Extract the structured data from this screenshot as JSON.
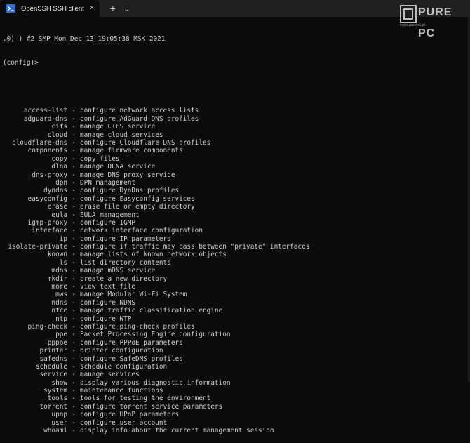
{
  "window": {
    "tab_title": "OpenSSH SSH client",
    "close_glyph": "×",
    "new_tab_glyph": "+",
    "dropdown_glyph": "⌄",
    "watermark": "PURE PC",
    "watermark_sub": "www.purepc.pl"
  },
  "terminal": {
    "header_line": ".0) ) #2 SMP Mon Dec 13 19:05:38 MSK 2021",
    "prompt": "(config)>",
    "separator": "-",
    "commands": [
      {
        "name": "access-list",
        "desc": "configure network access lists"
      },
      {
        "name": "adguard-dns",
        "desc": "configure AdGuard DNS profiles"
      },
      {
        "name": "cifs",
        "desc": "manage CIFS service"
      },
      {
        "name": "cloud",
        "desc": "manage cloud services"
      },
      {
        "name": "cloudflare-dns",
        "desc": "configure Cloudflare DNS profiles"
      },
      {
        "name": "components",
        "desc": "manage firmware components"
      },
      {
        "name": "copy",
        "desc": "copy files"
      },
      {
        "name": "dlna",
        "desc": "manage DLNA service"
      },
      {
        "name": "dns-proxy",
        "desc": "manage DNS proxy service"
      },
      {
        "name": "dpn",
        "desc": "DPN management"
      },
      {
        "name": "dyndns",
        "desc": "configure DynDns profiles"
      },
      {
        "name": "easyconfig",
        "desc": "configure Easyconfig services"
      },
      {
        "name": "erase",
        "desc": "erase file or empty directory"
      },
      {
        "name": "eula",
        "desc": "EULA management"
      },
      {
        "name": "igmp-proxy",
        "desc": "configure IGMP"
      },
      {
        "name": "interface",
        "desc": "network interface configuration"
      },
      {
        "name": "ip",
        "desc": "configure IP parameters"
      },
      {
        "name": "isolate-private",
        "desc": "configure if traffic may pass between \"private\" interfaces"
      },
      {
        "name": "known",
        "desc": "manage lists of known network objects"
      },
      {
        "name": "ls",
        "desc": "list directory contents"
      },
      {
        "name": "mdns",
        "desc": "manage mDNS service"
      },
      {
        "name": "mkdir",
        "desc": "create a new directory"
      },
      {
        "name": "more",
        "desc": "view text file"
      },
      {
        "name": "mws",
        "desc": "manage Modular Wi-Fi System"
      },
      {
        "name": "ndns",
        "desc": "configure NDNS"
      },
      {
        "name": "ntce",
        "desc": "manage traffic classification engine"
      },
      {
        "name": "ntp",
        "desc": "configure NTP"
      },
      {
        "name": "ping-check",
        "desc": "configure ping-check profiles"
      },
      {
        "name": "ppe",
        "desc": "Packet Processing Engine configuration"
      },
      {
        "name": "pppoe",
        "desc": "configure PPPoE parameters"
      },
      {
        "name": "printer",
        "desc": "printer configuration"
      },
      {
        "name": "safedns",
        "desc": "configure SafeDNS profiles"
      },
      {
        "name": "schedule",
        "desc": "schedule configuration"
      },
      {
        "name": "service",
        "desc": "manage services"
      },
      {
        "name": "show",
        "desc": "display various diagnostic information"
      },
      {
        "name": "system",
        "desc": "maintenance functions"
      },
      {
        "name": "tools",
        "desc": "tools for testing the environment"
      },
      {
        "name": "torrent",
        "desc": "configure torrent service parameters"
      },
      {
        "name": "upnp",
        "desc": "configure UPnP parameters"
      },
      {
        "name": "user",
        "desc": "configure user account"
      },
      {
        "name": "whoami",
        "desc": "display info about the current management session"
      }
    ]
  },
  "colors": {
    "terminal_bg": "#0c0c0c",
    "titlebar_bg": "#202020",
    "text": "#cccccc",
    "icon_accent": "#2f6fd1"
  },
  "icons": {
    "tab_icon": "powershell-icon"
  }
}
